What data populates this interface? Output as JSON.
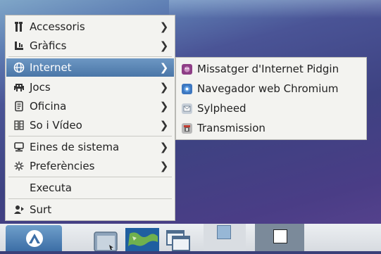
{
  "menu": {
    "items": [
      {
        "label": "Accessoris",
        "icon": "accessories-icon",
        "submenu": true
      },
      {
        "label": "Gràfics",
        "icon": "graphics-icon",
        "submenu": true
      },
      {
        "label": "Internet",
        "icon": "internet-icon",
        "submenu": true,
        "active": true
      },
      {
        "label": "Jocs",
        "icon": "games-icon",
        "submenu": true
      },
      {
        "label": "Oficina",
        "icon": "office-icon",
        "submenu": true
      },
      {
        "label": "So i Vídeo",
        "icon": "sound-video-icon",
        "submenu": true
      },
      {
        "label": "Eines de sistema",
        "icon": "system-tools-icon",
        "submenu": true
      },
      {
        "label": "Preferències",
        "icon": "preferences-icon",
        "submenu": true
      },
      {
        "label": "Executa",
        "icon": "",
        "submenu": false
      },
      {
        "label": "Surt",
        "icon": "logout-icon",
        "submenu": false
      }
    ],
    "arrow": "❯"
  },
  "submenu": {
    "items": [
      {
        "label": "Missatger d'Internet Pidgin",
        "icon": "pidgin-icon"
      },
      {
        "label": "Navegador web Chromium",
        "icon": "chromium-icon"
      },
      {
        "label": "Sylpheed",
        "icon": "sylpheed-icon"
      },
      {
        "label": "Transmission",
        "icon": "transmission-icon"
      }
    ]
  },
  "colors": {
    "highlight": "#5a86b6",
    "menu_bg": "#f3f3f0",
    "taskbar_bg": "#e3e6ea"
  }
}
